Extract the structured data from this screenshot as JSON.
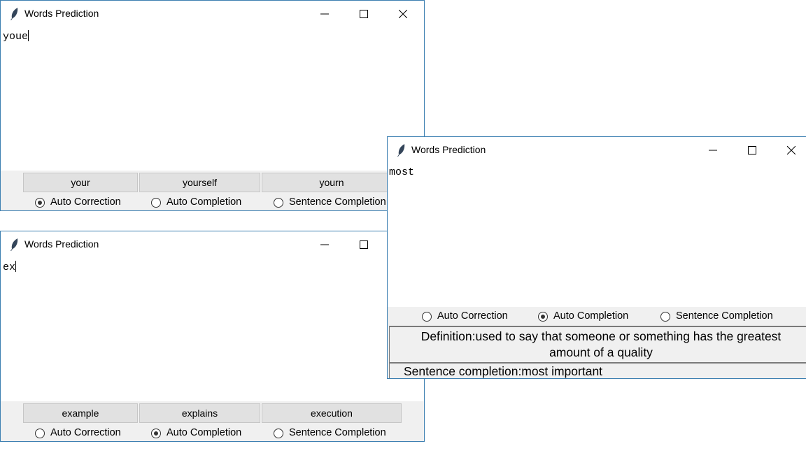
{
  "windows": {
    "w1": {
      "title": "Words Prediction",
      "text": "youe",
      "suggestions": [
        "your",
        "yourself",
        "yourn"
      ],
      "radios": [
        "Auto Correction",
        "Auto Completion",
        "Sentence Completion"
      ],
      "selected": "Auto Correction"
    },
    "w2": {
      "title": "Words Prediction",
      "text": "ex",
      "suggestions": [
        "example",
        "explains",
        "execution"
      ],
      "radios": [
        "Auto Correction",
        "Auto Completion",
        "Sentence Completion"
      ],
      "selected": "Auto Completion"
    },
    "w3": {
      "title": "Words Prediction",
      "text": "most",
      "radios": [
        "Auto Correction",
        "Auto Completion",
        "Sentence Completion"
      ],
      "selected": "Auto Completion",
      "definition": "Definition:used to say that someone or something has the greatest amount of a quality",
      "sentence_completion": "Sentence completion:most important"
    }
  }
}
